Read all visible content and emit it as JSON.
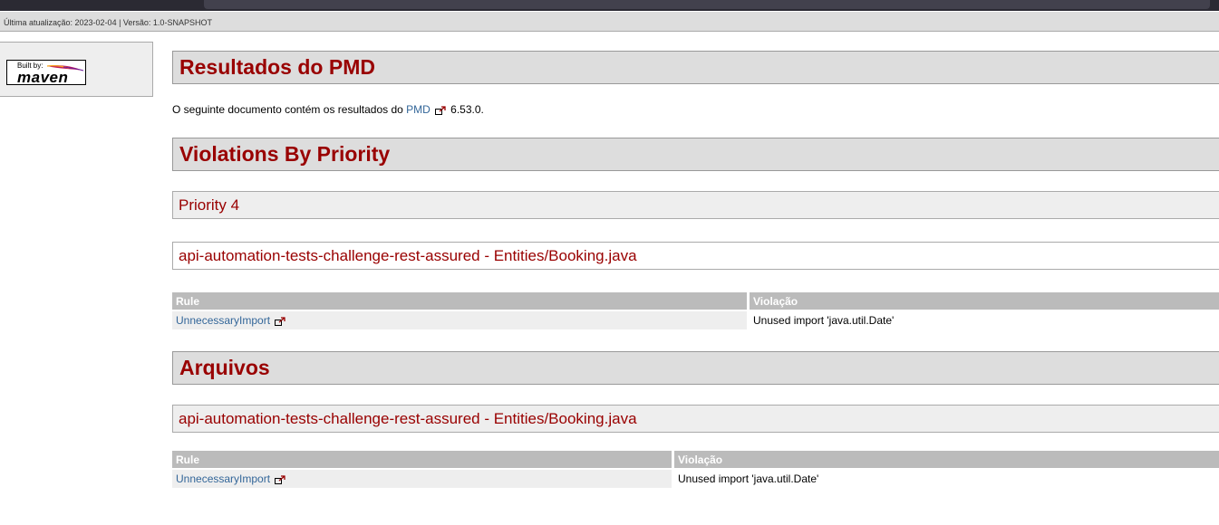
{
  "breadcrumb": "Última atualização: 2023-02-04 | Versão: 1.0-SNAPSHOT",
  "badge": {
    "built_by": "Built by:",
    "word": "maven"
  },
  "sections": {
    "results_title": "Resultados do PMD",
    "intro_prefix": "O seguinte documento contém os resultados do ",
    "intro_link": "PMD",
    "intro_suffix": " 6.53.0.",
    "violations_title": "Violations By Priority",
    "priority_title": "Priority 4",
    "file_title_1": "api-automation-tests-challenge-rest-assured - Entities/Booking.java",
    "files_title": "Arquivos",
    "file_title_2": "api-automation-tests-challenge-rest-assured - Entities/Booking.java"
  },
  "table1": {
    "headers": [
      "Rule",
      "Violação"
    ],
    "rows": [
      {
        "rule": "UnnecessaryImport",
        "violation": "Unused import 'java.util.Date'"
      }
    ]
  },
  "table2": {
    "headers": [
      "Rule",
      "Violação"
    ],
    "rows": [
      {
        "rule": "UnnecessaryImport",
        "violation": "Unused import 'java.util.Date'"
      }
    ]
  },
  "icons": {
    "external_link": "external-link-icon",
    "feather": "maven-feather-icon"
  },
  "colors": {
    "heading": "#990000",
    "link": "#336699",
    "table_header": "#bbbbbb"
  }
}
